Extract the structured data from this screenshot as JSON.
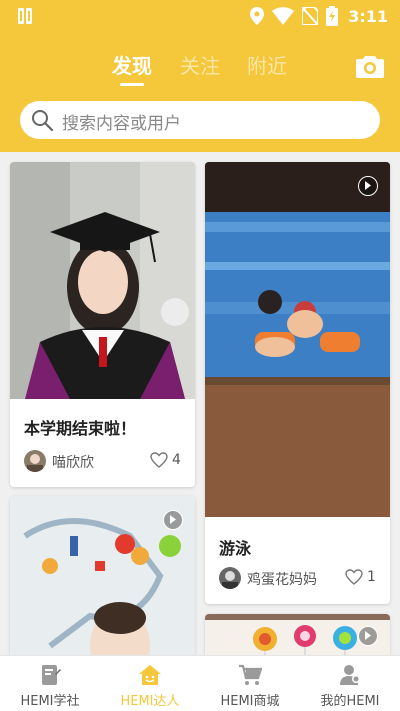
{
  "status_bar": {
    "time": "3:11"
  },
  "header": {
    "tabs": [
      {
        "label": "发现",
        "active": true
      },
      {
        "label": "关注",
        "active": false
      },
      {
        "label": "附近",
        "active": false
      }
    ],
    "camera_icon": "camera-icon"
  },
  "search": {
    "placeholder": "搜索内容或用户"
  },
  "feed": {
    "cards": [
      {
        "title": "本学期结束啦！",
        "author": "喵欣欣",
        "likes": "4",
        "has_video": false
      },
      {
        "title": "游泳",
        "author": "鸡蛋花妈妈",
        "likes": "1",
        "has_video": true
      },
      {
        "title": "",
        "author": "",
        "likes": "",
        "has_video": true
      },
      {
        "title": "",
        "author": "",
        "likes": "",
        "has_video": true
      }
    ]
  },
  "bottom_nav": {
    "items": [
      {
        "label": "HEMI学社",
        "icon": "notebook-icon",
        "active": false
      },
      {
        "label": "HEMI达人",
        "icon": "smiley-house-icon",
        "active": true
      },
      {
        "label": "HEMI商城",
        "icon": "shopping-cart-icon",
        "active": false
      },
      {
        "label": "我的HEMI",
        "icon": "user-icon",
        "active": false
      }
    ]
  },
  "colors": {
    "accent": "#F5C73A",
    "background": "#f0f0f0"
  }
}
